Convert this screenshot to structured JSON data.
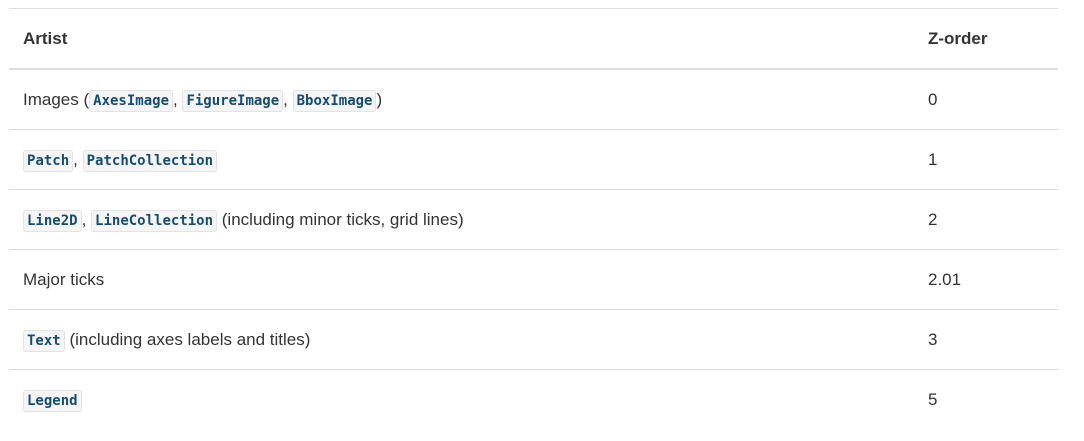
{
  "header": {
    "artist": "Artist",
    "zorder": "Z-order"
  },
  "rows": [
    {
      "parts": [
        {
          "t": "Images ("
        },
        {
          "c": "AxesImage"
        },
        {
          "t": ", "
        },
        {
          "c": "FigureImage"
        },
        {
          "t": ", "
        },
        {
          "c": "BboxImage"
        },
        {
          "t": ")"
        }
      ],
      "z": "0"
    },
    {
      "parts": [
        {
          "c": "Patch"
        },
        {
          "t": ", "
        },
        {
          "c": "PatchCollection"
        }
      ],
      "z": "1"
    },
    {
      "parts": [
        {
          "c": "Line2D"
        },
        {
          "t": ", "
        },
        {
          "c": "LineCollection"
        },
        {
          "t": " (including minor ticks, grid lines)"
        }
      ],
      "z": "2"
    },
    {
      "parts": [
        {
          "t": "Major ticks"
        }
      ],
      "z": "2.01"
    },
    {
      "parts": [
        {
          "c": "Text"
        },
        {
          "t": " (including axes labels and titles)"
        }
      ],
      "z": "3"
    },
    {
      "parts": [
        {
          "c": "Legend"
        }
      ],
      "z": "5"
    }
  ]
}
